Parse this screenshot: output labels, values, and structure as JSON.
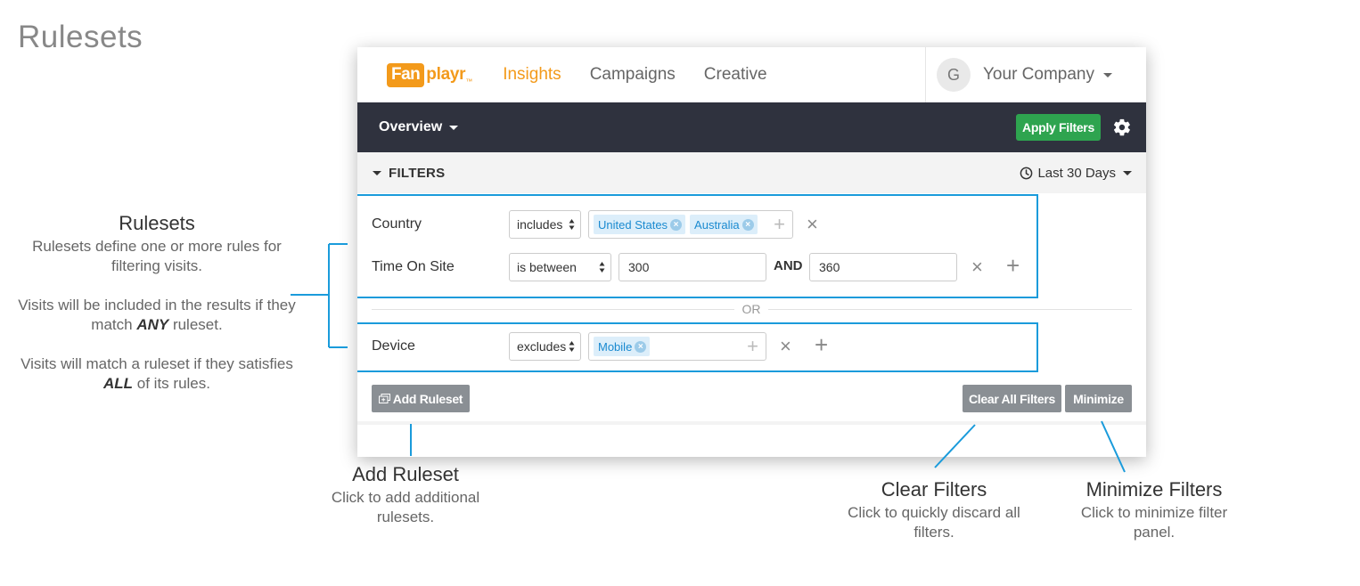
{
  "page": {
    "heading": "Rulesets"
  },
  "annotations": {
    "rulesets": {
      "title": "Rulesets",
      "p1": "Rulesets define one or more rules for filtering visits.",
      "p2_before": "Visits will be included in the results if they match ",
      "p2_emph": "ANY",
      "p2_after": " ruleset.",
      "p3_before": "Visits will match a ruleset if they satisfies ",
      "p3_emph": "ALL",
      "p3_after": " of its rules."
    },
    "add_ruleset": {
      "title": "Add Ruleset",
      "body": "Click to add additional rulesets."
    },
    "clear_filters": {
      "title": "Clear Filters",
      "body": "Click to quickly discard all filters."
    },
    "minimize_filters": {
      "title": "Minimize Filters",
      "body": "Click to minimize filter panel."
    }
  },
  "app": {
    "logo": {
      "box": "Fan",
      "rest": "playr",
      "tm": "™"
    },
    "nav": [
      {
        "label": "Insights",
        "active": true
      },
      {
        "label": "Campaigns",
        "active": false
      },
      {
        "label": "Creative",
        "active": false
      }
    ],
    "company": {
      "avatar_letter": "G",
      "name": "Your Company"
    },
    "toolbar": {
      "view_label": "Overview",
      "apply_label": "Apply Filters",
      "settings_icon": "gear-icon"
    },
    "filters": {
      "header": "FILTERS",
      "date_range": "Last 30 Days",
      "or_label": "OR",
      "rulesets": [
        {
          "rules": [
            {
              "field": "Country",
              "operator": "includes",
              "tags": [
                "United States",
                "Australia"
              ]
            },
            {
              "field": "Time On Site",
              "operator": "is between",
              "value1": "300",
              "and_label": "AND",
              "value2": "360"
            }
          ]
        },
        {
          "rules": [
            {
              "field": "Device",
              "operator": "excludes",
              "tags": [
                "Mobile"
              ]
            }
          ]
        }
      ],
      "add_ruleset_label": "Add Ruleset",
      "clear_all_label": "Clear All Filters",
      "minimize_label": "Minimize"
    }
  },
  "colors": {
    "brand_orange": "#f39a1b",
    "apply_green": "#2ea44f",
    "callout_blue": "#1a9bdb",
    "dark_bar": "#2f323e",
    "gray_button": "#8a8f94"
  }
}
